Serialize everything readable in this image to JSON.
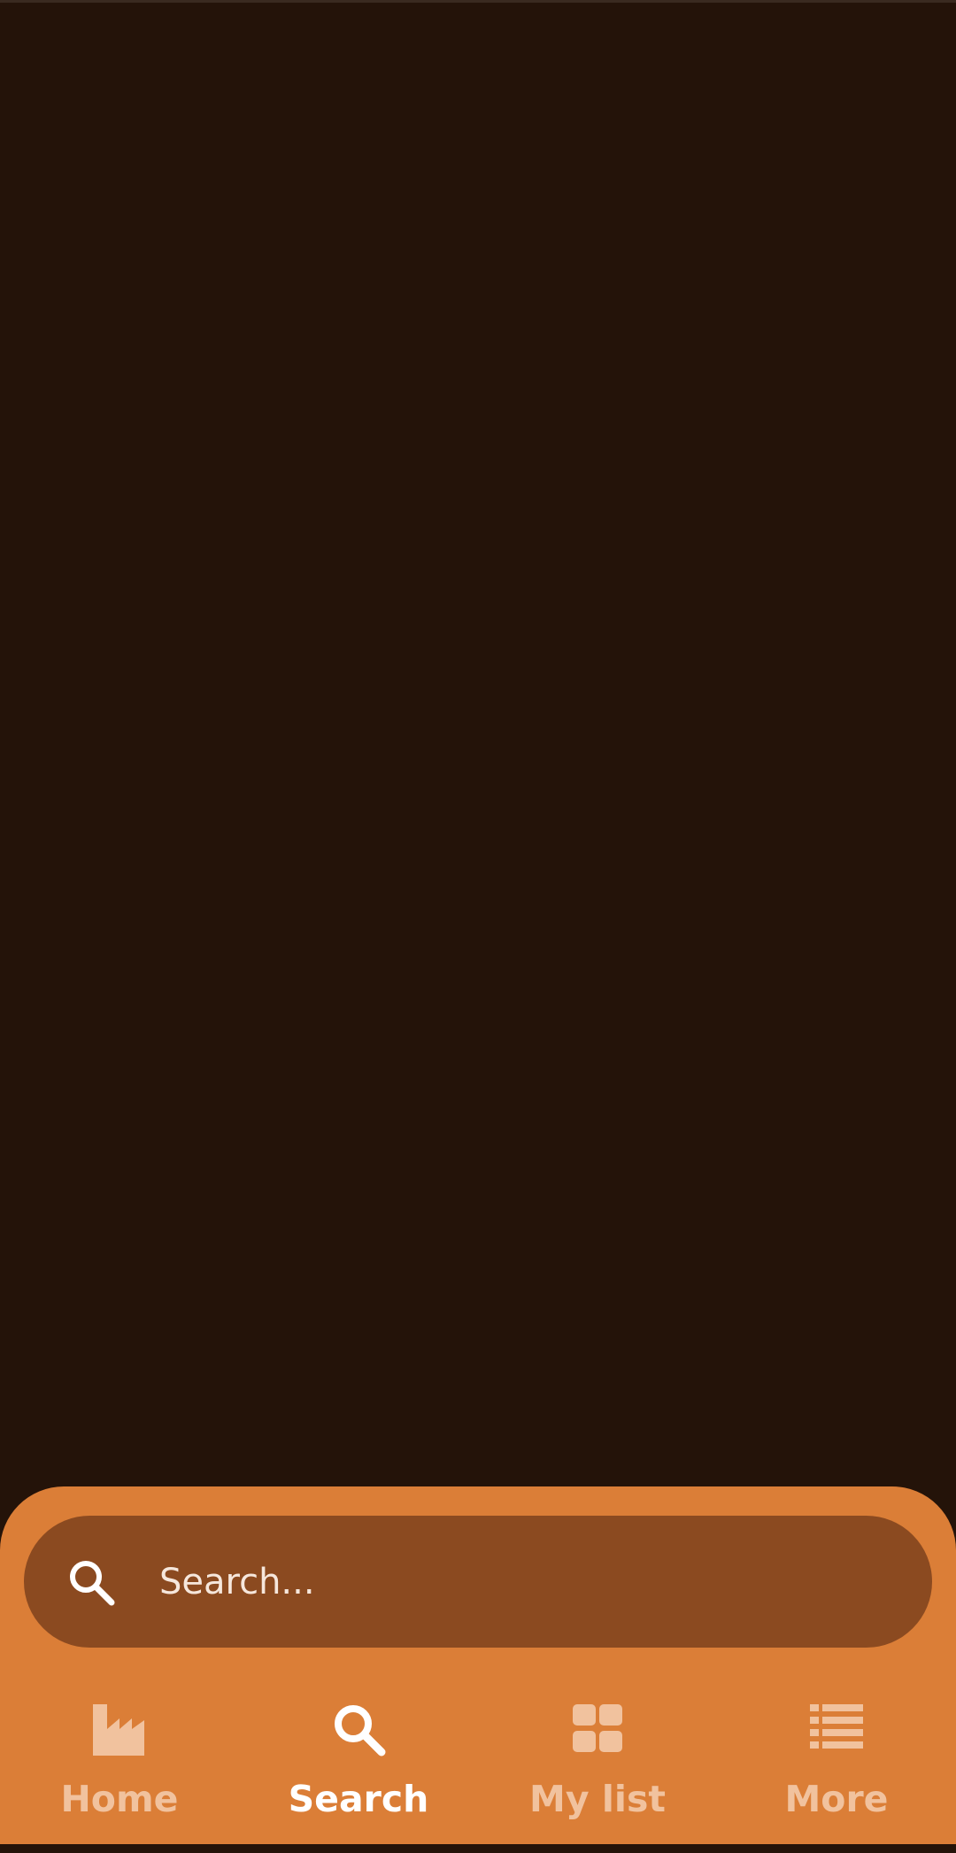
{
  "colors": {
    "background": "#241309",
    "panel": "#db7e37",
    "search_bar": "#8b4a20",
    "active": "#ffffff",
    "inactive": "#f1c29e"
  },
  "search": {
    "placeholder": "Search...",
    "icon": "search-icon"
  },
  "nav": {
    "items": [
      {
        "label": "Home",
        "icon": "factory-icon",
        "active": false
      },
      {
        "label": "Search",
        "icon": "search-icon",
        "active": true
      },
      {
        "label": "My list",
        "icon": "grid-icon",
        "active": false
      },
      {
        "label": "More",
        "icon": "list-icon",
        "active": false
      }
    ]
  }
}
